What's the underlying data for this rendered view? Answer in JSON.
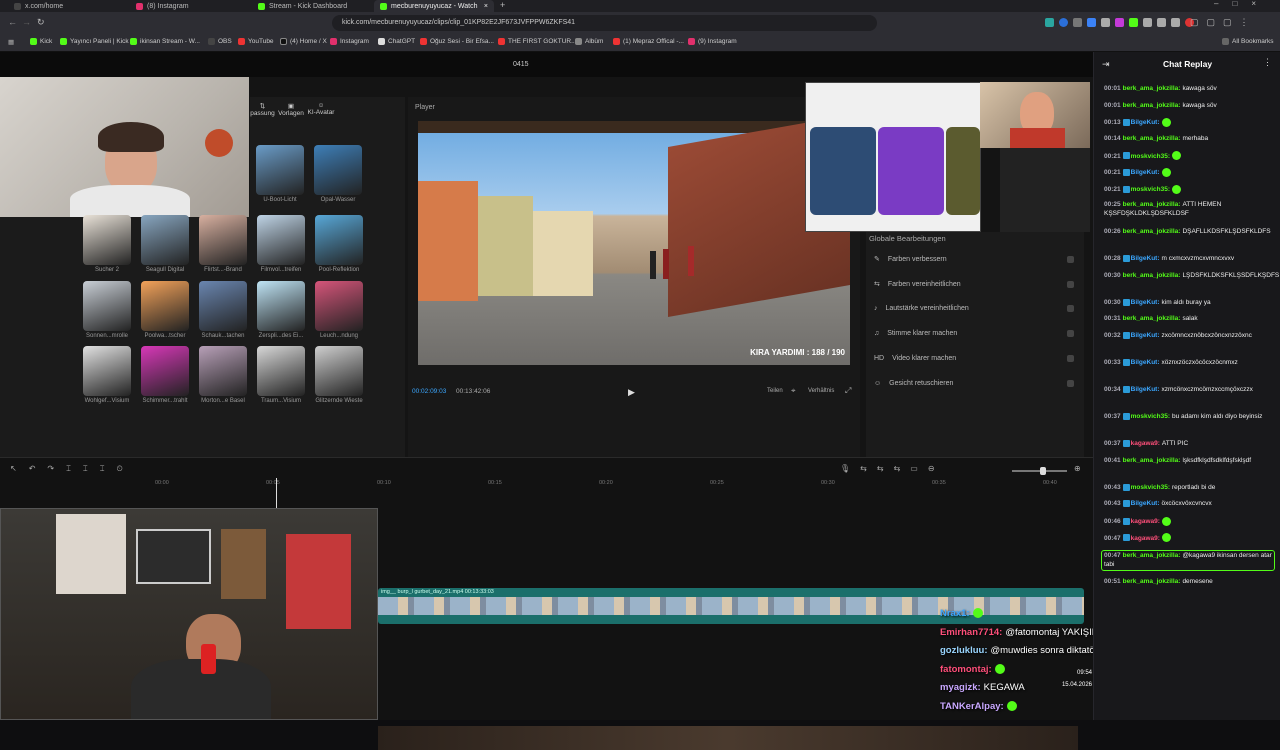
{
  "browser": {
    "tabs": [
      {
        "label": "x.com/home",
        "color": "#000000"
      },
      {
        "label": "(8) Instagram",
        "color": "#e1306c"
      },
      {
        "label": "Stream - Kick Dashboard",
        "color": "#53fc18"
      },
      {
        "label": "mecburenuyuyucaz - Watch",
        "color": "#53fc18"
      }
    ],
    "url": "kick.com/mecburenuyuyucaz/clips/clip_01KP82E2JF673JVFPPW6ZKFS41",
    "bookmarks": [
      "Kick",
      "Yayıncı Paneli | Kick",
      "ikinsan Stream - W...",
      "OBS",
      "YouTube",
      "(4) Home / X",
      "Instagram",
      "ChatGPT",
      "Oğuz Sesi - Bir Efsa...",
      "THE FIRST GOKTUR...",
      "Albüm",
      "(1) Mepraz Offical -...",
      "(9) Instagram"
    ],
    "all_bookmarks": "All Bookmarks"
  },
  "editor": {
    "top_timecode": "0415",
    "tools": [
      "passung",
      "Vorlagen",
      "KI-Avatar"
    ],
    "player_label": "Player",
    "thumb_labels": [
      "U-Boot-Licht",
      "Opal-Wasser",
      "Sucher 2",
      "Seagull Digital",
      "Flirtst...-Brand",
      "Filmvol...treifen",
      "Pool-Reflektion",
      "Sonnen...mrolle",
      "Poolwa...tscher",
      "Schauk...tachen",
      "Zerspli...des Ei...",
      "Leuch...ndung",
      "Wohlgef...Visium",
      "Schimmer...trahlt",
      "Morton...e Basel",
      "Traum...Visium",
      "Glitzernde Wieste"
    ],
    "video_caption": "KIRA YARDIMI : 188 / 190",
    "time_current": "00:02:09:03",
    "time_total": "00:13:42:06",
    "zoom_options": [
      "Teilen",
      "Verhältnis"
    ],
    "global_edit_title": "Globale Bearbeitungen",
    "global_edits": [
      "Farben verbessern",
      "Farben vereinheitlichen",
      "Lautstärke vereinheitlichen",
      "Stimme klarer machen",
      "Video klarer machen",
      "Gesicht retuschieren"
    ],
    "ruler": [
      "00:00",
      "00:05",
      "00:10",
      "00:15",
      "00:20",
      "00:25",
      "00:30",
      "00:35",
      "00:40"
    ],
    "clip_name": "img__ burp_l gurbet_day_21.mp4  00:13:33:03",
    "overlay_time": "09:54",
    "overlay_date": "15.04.2026"
  },
  "chat": {
    "title": "Chat Replay",
    "messages": [
      {
        "t": "00:01",
        "u": "berk_ama_jokzilla:",
        "c": "#53fc18",
        "m": "kawaga söv",
        "badge": false,
        "emote": false
      },
      {
        "t": "00:01",
        "u": "berk_ama_jokzilla:",
        "c": "#53fc18",
        "m": "kawaga söv",
        "badge": false,
        "emote": false
      },
      {
        "t": "00:13",
        "u": "BilgeKut:",
        "c": "#3ba7ff",
        "m": "",
        "badge": true,
        "emote": true
      },
      {
        "t": "00:14",
        "u": "berk_ama_jokzilla:",
        "c": "#53fc18",
        "m": "merhaba",
        "badge": false,
        "emote": false
      },
      {
        "t": "00:21",
        "u": "moskvich35:",
        "c": "#53fc18",
        "m": "",
        "badge": true,
        "emote": true
      },
      {
        "t": "00:21",
        "u": "BilgeKut:",
        "c": "#3ba7ff",
        "m": "",
        "badge": true,
        "emote": true
      },
      {
        "t": "00:21",
        "u": "moskvich35:",
        "c": "#53fc18",
        "m": "",
        "badge": true,
        "emote": true
      },
      {
        "t": "00:25",
        "u": "berk_ama_jokzilla:",
        "c": "#53fc18",
        "m": "ATTI HEMEN KŞSFDŞKLDKLŞDSFKLDSF",
        "badge": false,
        "emote": false
      },
      {
        "t": "00:26",
        "u": "berk_ama_jokzilla:",
        "c": "#53fc18",
        "m": "DŞAFLLKDSFKLŞDSFKLDFS",
        "badge": false,
        "emote": false
      },
      {
        "t": "00:28",
        "u": "BilgeKut:",
        "c": "#3ba7ff",
        "m": "m cxmcxvzmcxvmncxvxv",
        "badge": true,
        "emote": false
      },
      {
        "t": "00:30",
        "u": "berk_ama_jokzilla:",
        "c": "#53fc18",
        "m": "LŞDSFKLDKSFKLŞSDFLKŞDFS",
        "badge": false,
        "emote": false
      },
      {
        "t": "00:30",
        "u": "BilgeKut:",
        "c": "#3ba7ff",
        "m": "kim aldı buray ya",
        "badge": true,
        "emote": false
      },
      {
        "t": "00:31",
        "u": "berk_ama_jokzilla:",
        "c": "#53fc18",
        "m": "salak",
        "badge": false,
        "emote": false
      },
      {
        "t": "00:32",
        "u": "BilgeKut:",
        "c": "#3ba7ff",
        "m": "zxcömncxznöbcxzöncxnzzöxnc",
        "badge": true,
        "emote": false
      },
      {
        "t": "00:33",
        "u": "BilgeKut:",
        "c": "#3ba7ff",
        "m": "xöznxzöczxöcöcxzöcnmxz",
        "badge": true,
        "emote": false
      },
      {
        "t": "00:34",
        "u": "BilgeKut:",
        "c": "#3ba7ff",
        "m": "xzmcönxczmcömzxccmçöxczzx",
        "badge": true,
        "emote": false
      },
      {
        "t": "00:37",
        "u": "moskvich35:",
        "c": "#53fc18",
        "m": "bu adamı kim aldı diyo beyinsiz",
        "badge": true,
        "emote": false
      },
      {
        "t": "00:37",
        "u": "kagawa9:",
        "c": "#ff4f7a",
        "m": "ATTI PIC",
        "badge": true,
        "emote": false
      },
      {
        "t": "00:41",
        "u": "berk_ama_jokzilla:",
        "c": "#53fc18",
        "m": "lşksdfklşdfsdklfdşfsklşdf",
        "badge": false,
        "emote": false
      },
      {
        "t": "00:43",
        "u": "moskvich35:",
        "c": "#53fc18",
        "m": "reportladı bi de",
        "badge": true,
        "emote": false
      },
      {
        "t": "00:43",
        "u": "BilgeKut:",
        "c": "#3ba7ff",
        "m": "öxcöcxvöxcvncvx",
        "badge": true,
        "emote": false
      },
      {
        "t": "00:46",
        "u": "kagawa9:",
        "c": "#ff4f7a",
        "m": "",
        "badge": true,
        "emote": true
      },
      {
        "t": "00:47",
        "u": "kagawa9:",
        "c": "#ff4f7a",
        "m": "",
        "badge": true,
        "emote": true
      },
      {
        "t": "00:47",
        "u": "berk_ama_jokzilla:",
        "c": "#53fc18",
        "m": "@kagawa9 ikinsan dersen atar tabi",
        "badge": false,
        "emote": false,
        "highlight": true
      },
      {
        "t": "00:51",
        "u": "berk_ama_jokzilla:",
        "c": "#53fc18",
        "m": "demesene",
        "badge": false,
        "emote": false
      }
    ]
  },
  "overlay_chat": [
    {
      "u": "Nrax1:",
      "c": "#3ba7ff",
      "m": "",
      "emote": true
    },
    {
      "u": "Emirhan7714:",
      "c": "#ff4f7a",
      "m": "@fatomontaj YAKIŞIKLI ERKEGİM BENİM",
      "emote": false
    },
    {
      "u": "gozlukluu:",
      "c": "#9ad6ff",
      "m": "@muwdies sonra diktatörden şikayet edersin kafanızı s",
      "emote": false
    },
    {
      "u": "fatomontaj:",
      "c": "#ff4f7a",
      "m": "",
      "emote": true
    },
    {
      "u": "myagizk:",
      "c": "#c9a8ff",
      "m": "KEGAWA",
      "emote": false
    },
    {
      "u": "TANKerAlpay:",
      "c": "#c9a8ff",
      "m": "",
      "emote": true
    }
  ]
}
